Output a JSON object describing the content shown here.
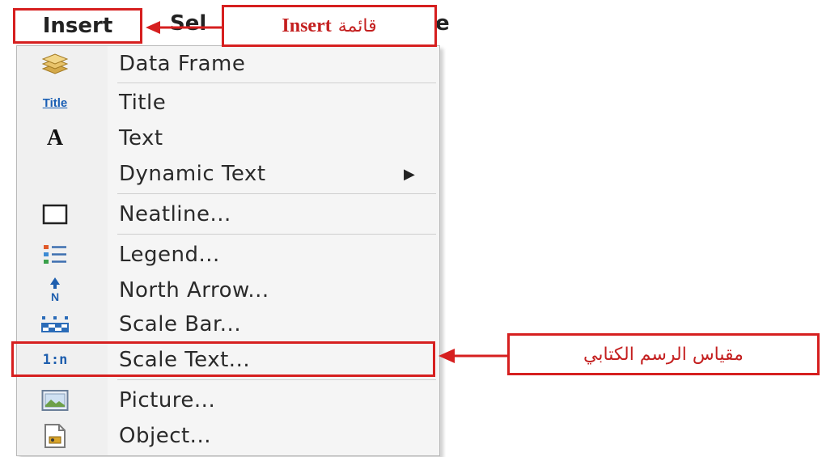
{
  "menubar": {
    "insert_label": "Insert",
    "next_label_partial": "Sel",
    "next_tail_partial": "e"
  },
  "annotations": {
    "insert_menu_en": "Insert",
    "insert_menu_ar": "قائمة",
    "scale_text_ar": "مقياس الرسم الكتابي",
    "color": "#d61f1f"
  },
  "menu": {
    "items": [
      {
        "label": "Data Frame",
        "icon": "data-frame-icon"
      },
      {
        "label": "Title",
        "icon": "title-icon"
      },
      {
        "label": "Text",
        "icon": "text-icon"
      },
      {
        "label": "Dynamic Text",
        "icon": "dynamic-text-icon",
        "submenu": true
      },
      {
        "label": "Neatline...",
        "icon": "neatline-icon"
      },
      {
        "label": "Legend...",
        "icon": "legend-icon"
      },
      {
        "label": "North Arrow...",
        "icon": "north-arrow-icon"
      },
      {
        "label": "Scale Bar...",
        "icon": "scale-bar-icon"
      },
      {
        "label": "Scale Text...",
        "icon": "scale-text-icon",
        "highlighted": true
      },
      {
        "label": "Picture...",
        "icon": "picture-icon"
      },
      {
        "label": "Object...",
        "icon": "object-icon"
      }
    ],
    "icon_text": {
      "title": "Title",
      "text": "A",
      "north": "N",
      "scale_text": "1:n"
    },
    "submenu_arrow": "▶"
  }
}
